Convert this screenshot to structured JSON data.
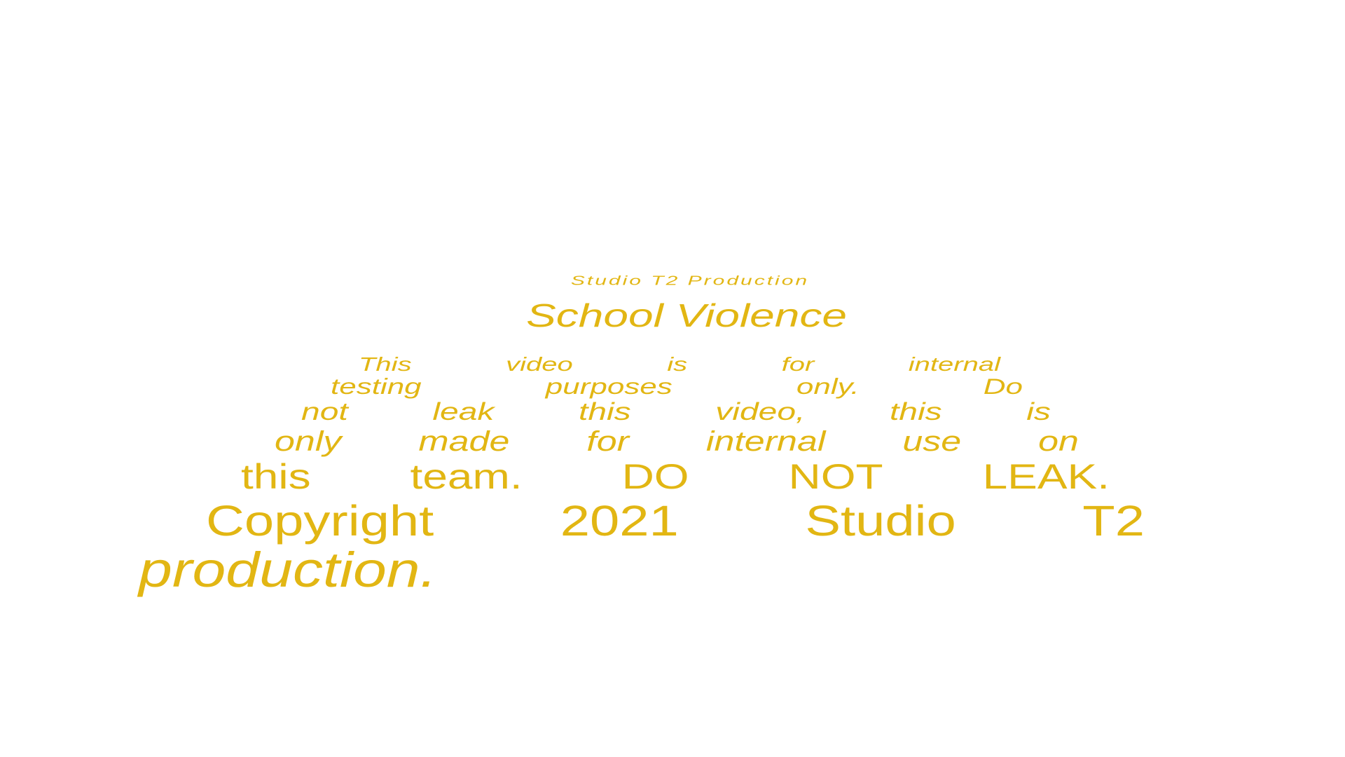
{
  "crawl": {
    "small_heading": "Studio T2 Production",
    "title": "School Violence",
    "lines": [
      "This video is for internal",
      "testing purposes only. Do",
      "not leak this video, this is",
      "only made for internal use on",
      "this team. DO NOT LEAK.",
      "Copyright 2021 Studio T2",
      "production."
    ]
  },
  "colors": {
    "background": "#ffffff",
    "text": "#E2B613"
  }
}
